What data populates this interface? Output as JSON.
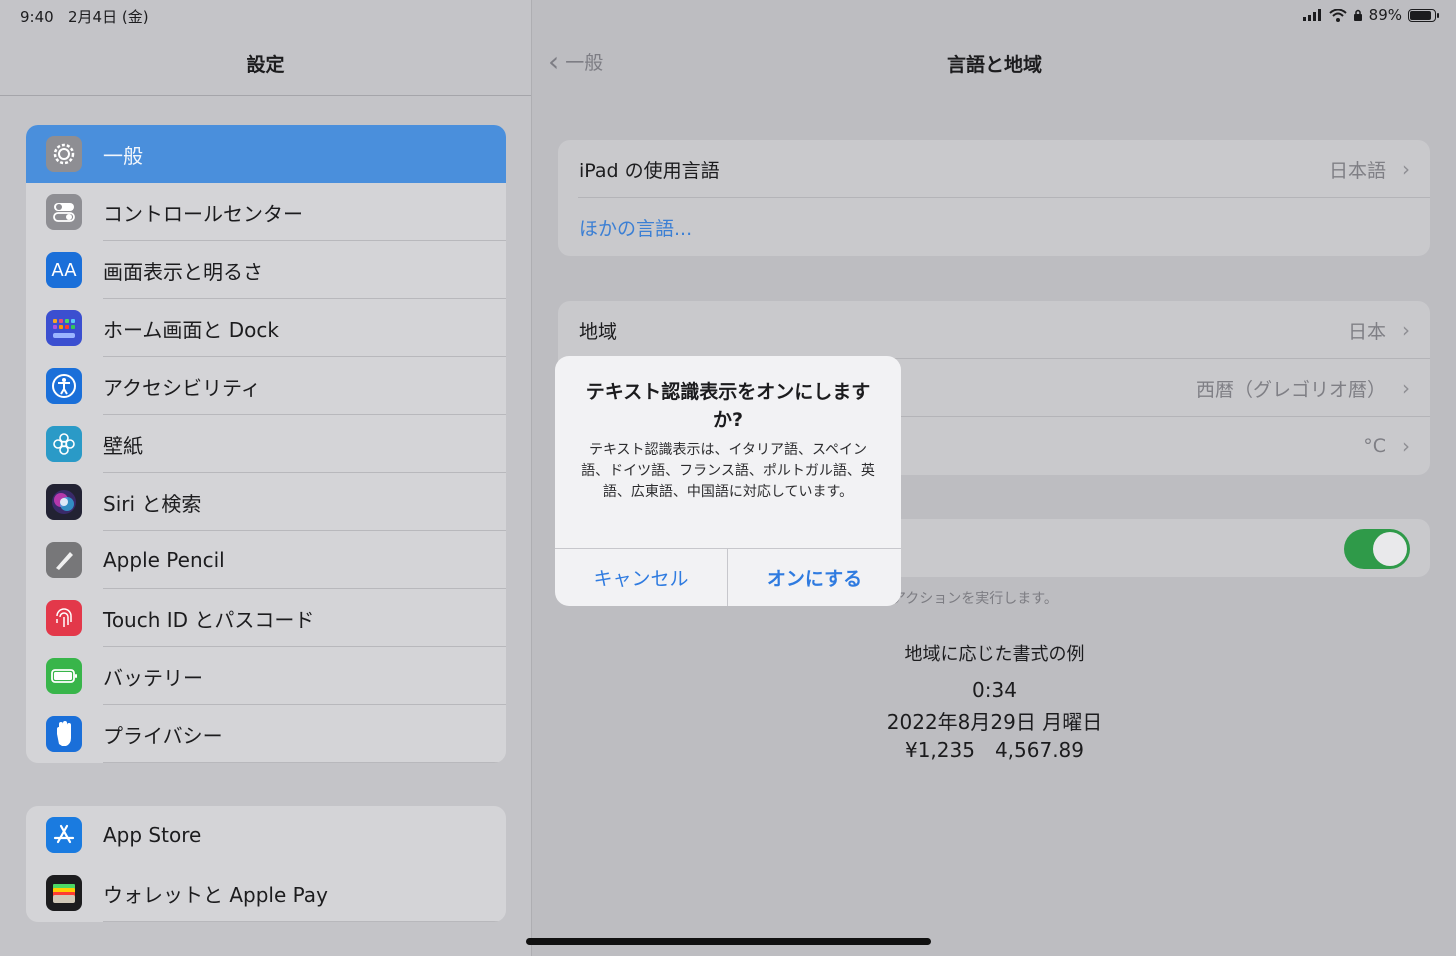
{
  "status": {
    "time": "9:40",
    "date": "2月4日 (金)",
    "battery": "89%",
    "battery_level": 0.89
  },
  "sidebar": {
    "title": "設定",
    "groups": [
      [
        {
          "label": "一般",
          "icon": "gear-icon",
          "color": "#8e8e93",
          "selected": true
        },
        {
          "label": "コントロールセンター",
          "icon": "toggles-icon",
          "color": "#8e8e93"
        },
        {
          "label": "画面表示と明るさ",
          "icon": "text-size-icon",
          "color": "#1a6fd9",
          "glyph": "AA"
        },
        {
          "label": "ホーム画面と Dock",
          "icon": "home-grid-icon",
          "color": "#3b4fd0"
        },
        {
          "label": "アクセシビリティ",
          "icon": "accessibility-icon",
          "color": "#1a6fd9"
        },
        {
          "label": "壁紙",
          "icon": "flower-icon",
          "color": "#2a9ac7"
        },
        {
          "label": "Siri と検索",
          "icon": "siri-icon",
          "color": "#222233"
        },
        {
          "label": "Apple Pencil",
          "icon": "pencil-icon",
          "color": "#777779"
        },
        {
          "label": "Touch ID とパスコード",
          "icon": "fingerprint-icon",
          "color": "#e3384a"
        },
        {
          "label": "バッテリー",
          "icon": "battery-icon",
          "color": "#38b54a"
        },
        {
          "label": "プライバシー",
          "icon": "hand-icon",
          "color": "#1a6fd9"
        }
      ],
      [
        {
          "label": "App Store",
          "icon": "app-store-icon",
          "color": "#1a7be0"
        },
        {
          "label": "ウォレットと Apple Pay",
          "icon": "wallet-icon",
          "color": "#1c1c1e"
        }
      ]
    ]
  },
  "nav": {
    "back_label": "一般",
    "title": "言語と地域"
  },
  "language_card": {
    "ipad_language_label": "iPad の使用言語",
    "ipad_language_value": "日本語",
    "other_languages_link": "ほかの言語..."
  },
  "region_card": {
    "region_label": "地域",
    "region_value": "日本",
    "calendar_value": "西暦（グレゴリオ暦）",
    "temperature_value": "°C"
  },
  "live_text": {
    "toggle_on": true,
    "footnote": "アクションを実行します。"
  },
  "example": {
    "heading": "地域に応じた書式の例",
    "time": "0:34",
    "date": "2022年8月29日 月曜日",
    "numbers": "¥1,235　4,567.89"
  },
  "alert": {
    "title": "テキスト認識表示をオンにしますか?",
    "message": "テキスト認識表示は、イタリア語、スペイン語、ドイツ語、フランス語、ポルトガル語、英語、広東語、中国語に対応しています。",
    "cancel_label": "キャンセル",
    "confirm_label": "オンにする"
  }
}
